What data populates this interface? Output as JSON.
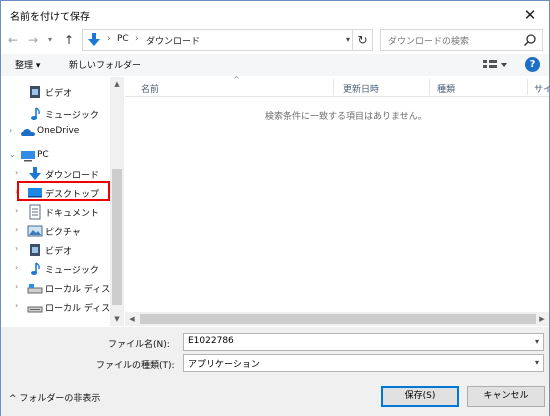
{
  "window": {
    "title": "名前を付けて保存",
    "close_glyph": "✕"
  },
  "address": {
    "crumbs": [
      "PC",
      "ダウンロード"
    ],
    "separator": "›",
    "search_placeholder": "ダウンロードの検索"
  },
  "toolbar": {
    "organize": "整理 ▾",
    "new_folder": "新しいフォルダー"
  },
  "tree": {
    "items": [
      {
        "label": "ビデオ",
        "icon": "video-icon"
      },
      {
        "label": "ミュージック",
        "icon": "music-icon"
      },
      {
        "label": "OneDrive",
        "icon": "cloud-icon"
      },
      {
        "label": "PC",
        "icon": "computer-icon"
      },
      {
        "label": "ダウンロード",
        "icon": "download-icon"
      },
      {
        "label": "デスクトップ",
        "icon": "desktop-icon"
      },
      {
        "label": "ドキュメント",
        "icon": "document-icon"
      },
      {
        "label": "ピクチャ",
        "icon": "picture-icon"
      },
      {
        "label": "ビデオ",
        "icon": "video-icon"
      },
      {
        "label": "ミュージック",
        "icon": "music-icon"
      },
      {
        "label": "ローカル ディスク (C",
        "icon": "drive-icon"
      },
      {
        "label": "ローカル ディスク (D",
        "icon": "drive-icon"
      }
    ]
  },
  "list": {
    "columns": [
      "名前",
      "更新日時",
      "種類",
      "サイズ"
    ],
    "empty_message": "検索条件に一致する項目はありません。"
  },
  "bottom": {
    "filename_label": "ファイル名(N):",
    "filename_value": "E1022786",
    "filetype_label": "ファイルの種類(T):",
    "filetype_value": "アプリケーション",
    "hide_folders": "^  フォルダーの非表示",
    "save": "保存(S)",
    "cancel": "キャンセル"
  },
  "colors": {
    "accent": "#1b6fc7",
    "highlight": "#e00000",
    "button_focus": "#0078d7"
  }
}
